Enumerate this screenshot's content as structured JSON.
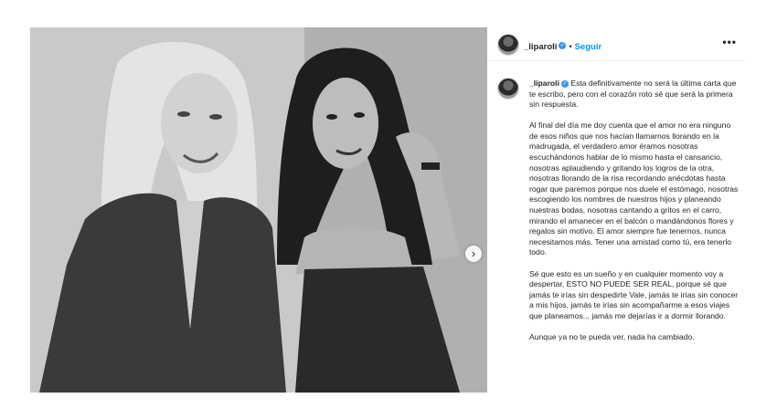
{
  "header": {
    "username": "_liparoli",
    "separator": "•",
    "follow_label": "Seguir",
    "more_label": "•••",
    "verified_icon": "verified-badge-icon",
    "verified_color": "#3897f0",
    "follow_color": "#0095f6"
  },
  "caption": {
    "username": "_liparoli",
    "first_text": "Esta definitivamente no será la última carta que te escribo, pero con el corazón roto sé que será la primera sin respuesta.",
    "paragraphs": [
      "Al final del día me doy cuenta que el amor no era ninguno de esos niños que nos hacían llamarnos llorando en la madrugada, el verdadero amor éramos nosotras escuchándonos hablar de lo mismo hasta el cansancio, nosotras aplaudiendo y gritando los logros de la otra, nosotras llorando de la risa recordando anécdotas hasta rogar que paremos porque nos duele el estómago, nosotras escogiendo los nombres de nuestros hijos y planeando nuestras bodas, nosotras cantando a gritos en el carro, mirando el amanecer en el balcón o mandándonos flores y regalos sin motivo. El amor siempre fue tenernos, nunca necesitamos más. Tener una amistad como tú, era tenerlo todo.",
      "Sé que esto es un sueño y en cualquier momento voy a despertar, ESTO NO PUEDE SER REAL, porque sé que jamás te irías sin despedirte Vale, jamás te irías sin conocer a mis hijos, jamás te irías sin acompañarme a esos viajes que planeamos... jamás me dejarías ir a dormir llorando.",
      "Aunque ya no te pueda ver, nada ha cambiado."
    ]
  },
  "carousel": {
    "next_icon": "chevron-right-icon",
    "next_glyph": "›"
  }
}
